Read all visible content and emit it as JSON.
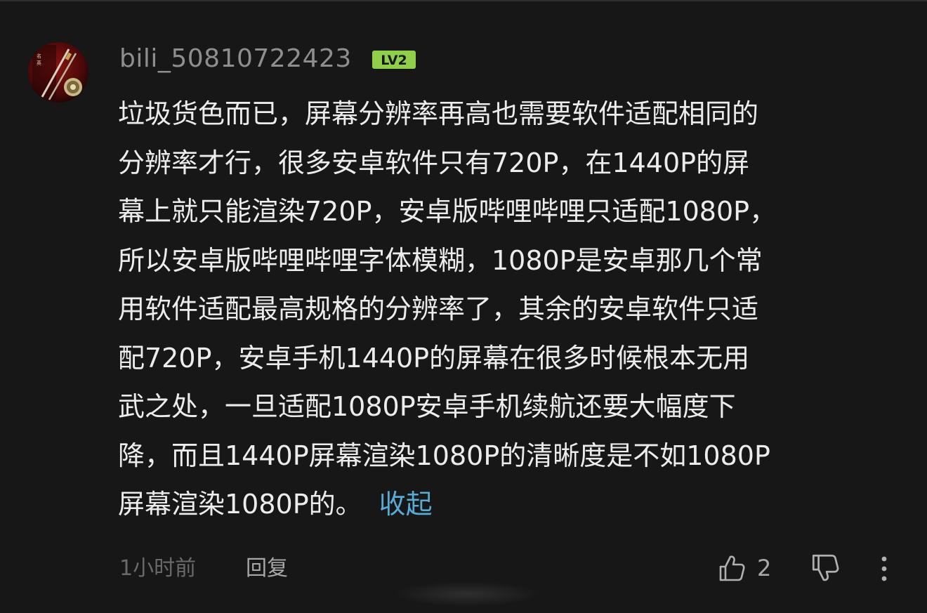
{
  "comment": {
    "username": "bili_50810722423",
    "level_badge": "LV2",
    "content_text": "垃圾货色而已，屏幕分辨率再高也需要软件适配相同的\n分辨率才行，很多安卓软件只有720P，在1440P的屏\n幕上就只能渲染720P，安卓版哔哩哔哩只适配1080P，\n所以安卓版哔哩哔哩字体模糊，1080P是安卓那几个常\n用软件适配最高规格的分辨率了，其余的安卓软件只适\n配720P，安卓手机1440P的屏幕在很多时候根本无用\n武之处，一旦适配1080P安卓手机续航还要大幅度下\n降，而且1440P屏幕渲染1080P的清晰度是不如1080P\n屏幕渲染1080P的。",
    "collapse_label": "收起",
    "time": "1小时前",
    "reply_label": "回复",
    "like_count": "2"
  },
  "icons": {
    "avatar": "avatar-image",
    "like": "thumbs-up-icon",
    "dislike": "thumbs-down-icon",
    "more": "more-vertical-icon"
  },
  "colors": {
    "background": "#171717",
    "username": "#8e8e8e",
    "content": "#ececec",
    "collapse_link": "#5aaad6",
    "level_badge": "#8fcf4a",
    "meta": "#6a6a6a"
  }
}
